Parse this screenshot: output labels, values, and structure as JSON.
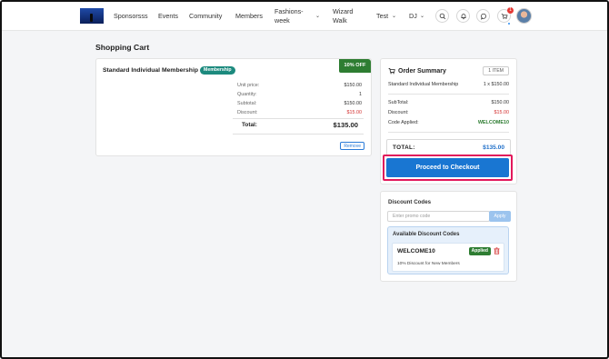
{
  "nav": {
    "items": [
      "Sponsorsss",
      "Events",
      "Community",
      "Members",
      "Fashions-week",
      "Wizard Walk",
      "Test",
      "DJ"
    ],
    "cart_count": "1"
  },
  "page": {
    "title": "Shopping Cart"
  },
  "cart": {
    "item_name": "Standard Individual Membership",
    "tag": "Membership",
    "discount_badge": "10% OFF",
    "rows": [
      {
        "label": "Unit price:",
        "value": "$150.00"
      },
      {
        "label": "Quantity:",
        "value": "1"
      },
      {
        "label": "Subtotal:",
        "value": "$150.00"
      },
      {
        "label": "Discount:",
        "value": "$15.00"
      }
    ],
    "total_label": "Total:",
    "total_value": "$135.00",
    "remove_label": "Remove"
  },
  "summary": {
    "title": "Order Summary",
    "item_count": "1 ITEM",
    "line_name": "Standard Individual Membership",
    "line_qty": "1 x $150.00",
    "subtotal_label": "SubTotal:",
    "subtotal_value": "$150.00",
    "discount_label": "Discount:",
    "discount_value": "$15.00",
    "code_label": "Code Applied:",
    "code_value": "WELCOME10",
    "total_label": "TOTAL:",
    "total_value": "$135.00",
    "checkout_label": "Proceed to Checkout"
  },
  "discounts": {
    "title": "Discount Codes",
    "placeholder": "Enter promo code",
    "apply_label": "Apply",
    "available_title": "Available Discount Codes",
    "code": "WELCOME10",
    "status": "Applied",
    "description": "10% Discount for New Members"
  },
  "colors": {
    "primary": "#1976d2",
    "success": "#2e7d32",
    "danger": "#d32f2f",
    "highlight": "#e2185b",
    "teal": "#1c8a7e"
  }
}
